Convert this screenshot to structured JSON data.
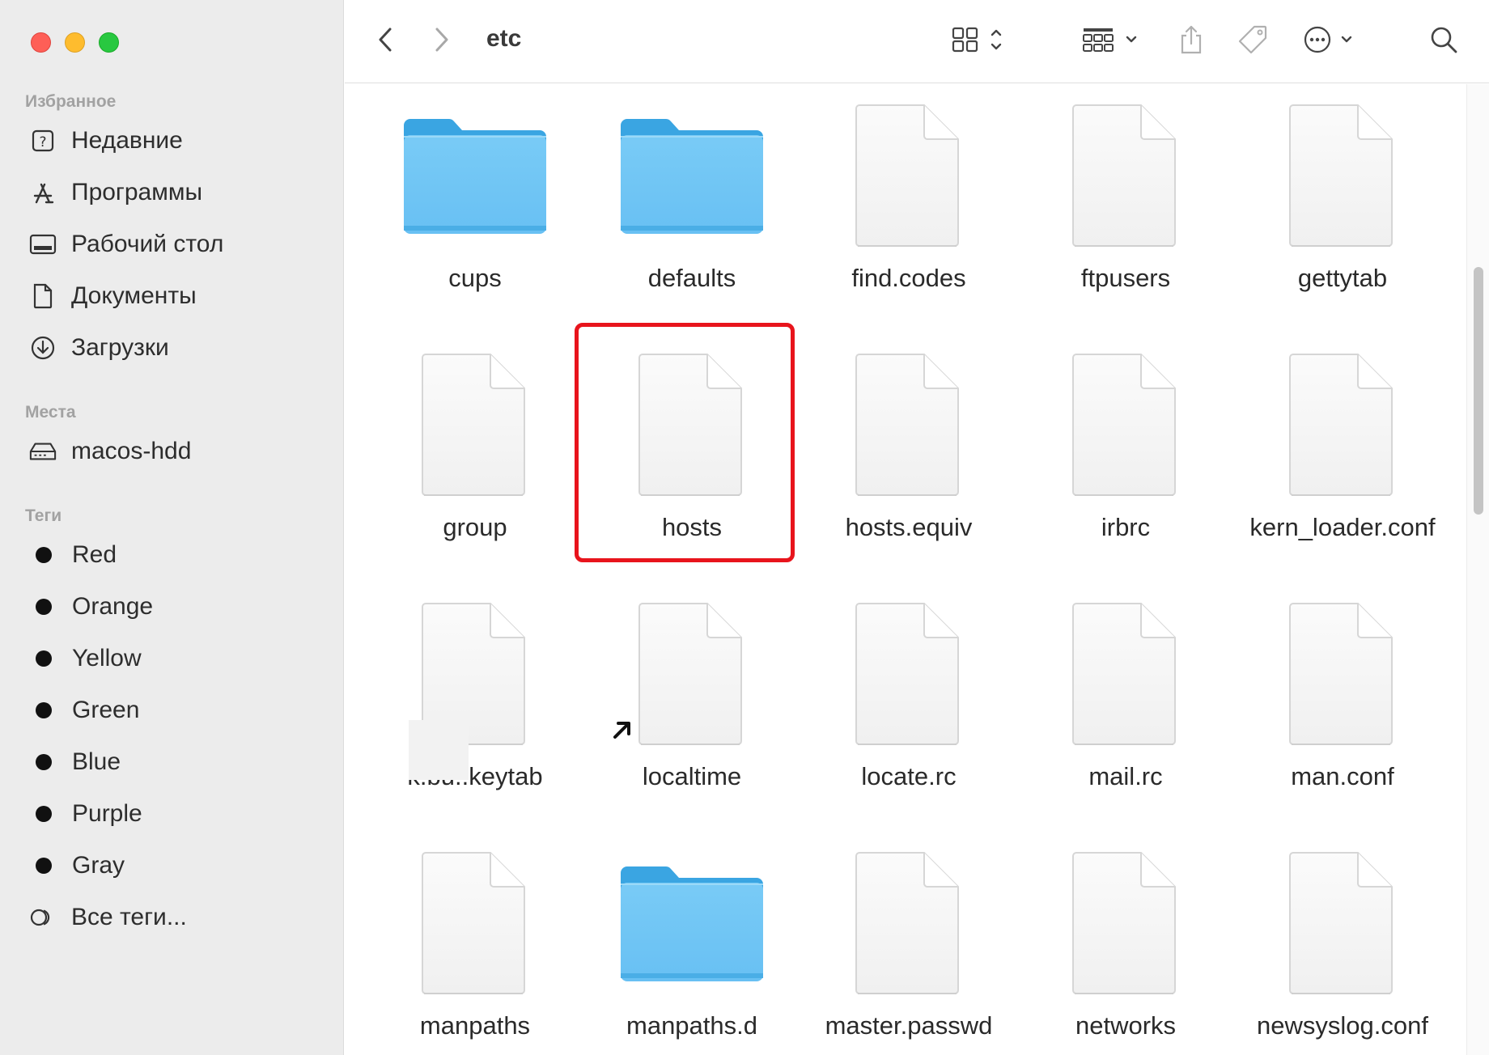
{
  "window": {
    "traffic_lights": [
      "close",
      "minimize",
      "zoom"
    ]
  },
  "sidebar": {
    "favorites": {
      "title": "Избранное",
      "items": [
        {
          "label": "Недавние",
          "icon": "recents-icon"
        },
        {
          "label": "Программы",
          "icon": "applications-icon"
        },
        {
          "label": "Рабочий стол",
          "icon": "desktop-icon"
        },
        {
          "label": "Документы",
          "icon": "document-icon"
        },
        {
          "label": "Загрузки",
          "icon": "downloads-icon"
        }
      ]
    },
    "locations": {
      "title": "Места",
      "items": [
        {
          "label": "macos-hdd",
          "icon": "hard-drive-icon"
        }
      ]
    },
    "tags": {
      "title": "Теги",
      "items": [
        {
          "label": "Red"
        },
        {
          "label": "Orange"
        },
        {
          "label": "Yellow"
        },
        {
          "label": "Green"
        },
        {
          "label": "Blue"
        },
        {
          "label": "Purple"
        },
        {
          "label": "Gray"
        },
        {
          "label": "Все теги..."
        }
      ]
    }
  },
  "toolbar": {
    "folder_title": "etc",
    "icons": [
      "back-icon",
      "forward-icon",
      "view-mode-icon",
      "group-icon",
      "share-icon",
      "tag-icon",
      "more-actions-icon",
      "search-icon"
    ]
  },
  "files": {
    "rows": [
      [
        {
          "name": "cups",
          "type": "folder"
        },
        {
          "name": "defaults",
          "type": "folder"
        },
        {
          "name": "find.codes",
          "type": "file"
        },
        {
          "name": "ftpusers",
          "type": "file"
        },
        {
          "name": "gettytab",
          "type": "file"
        }
      ],
      [
        {
          "name": "group",
          "type": "file"
        },
        {
          "name": "hosts",
          "type": "file",
          "highlighted": true
        },
        {
          "name": "hosts.equiv",
          "type": "file"
        },
        {
          "name": "irbrc",
          "type": "file"
        },
        {
          "name": "kern_loader.conf",
          "type": "file"
        }
      ],
      [
        {
          "name": "k.bu..keytab",
          "type": "file"
        },
        {
          "name": "localtime",
          "type": "alias"
        },
        {
          "name": "locate.rc",
          "type": "file"
        },
        {
          "name": "mail.rc",
          "type": "file"
        },
        {
          "name": "man.conf",
          "type": "file"
        }
      ],
      [
        {
          "name": "manpaths",
          "type": "file"
        },
        {
          "name": "manpaths.d",
          "type": "folder"
        },
        {
          "name": "master.passwd",
          "type": "file"
        },
        {
          "name": "networks",
          "type": "file"
        },
        {
          "name": "newsyslog.conf",
          "type": "file"
        }
      ]
    ]
  },
  "colors": {
    "highlight": "#e8141c",
    "folder": "#5ab8f0",
    "sidebar_bg": "#ececec"
  }
}
